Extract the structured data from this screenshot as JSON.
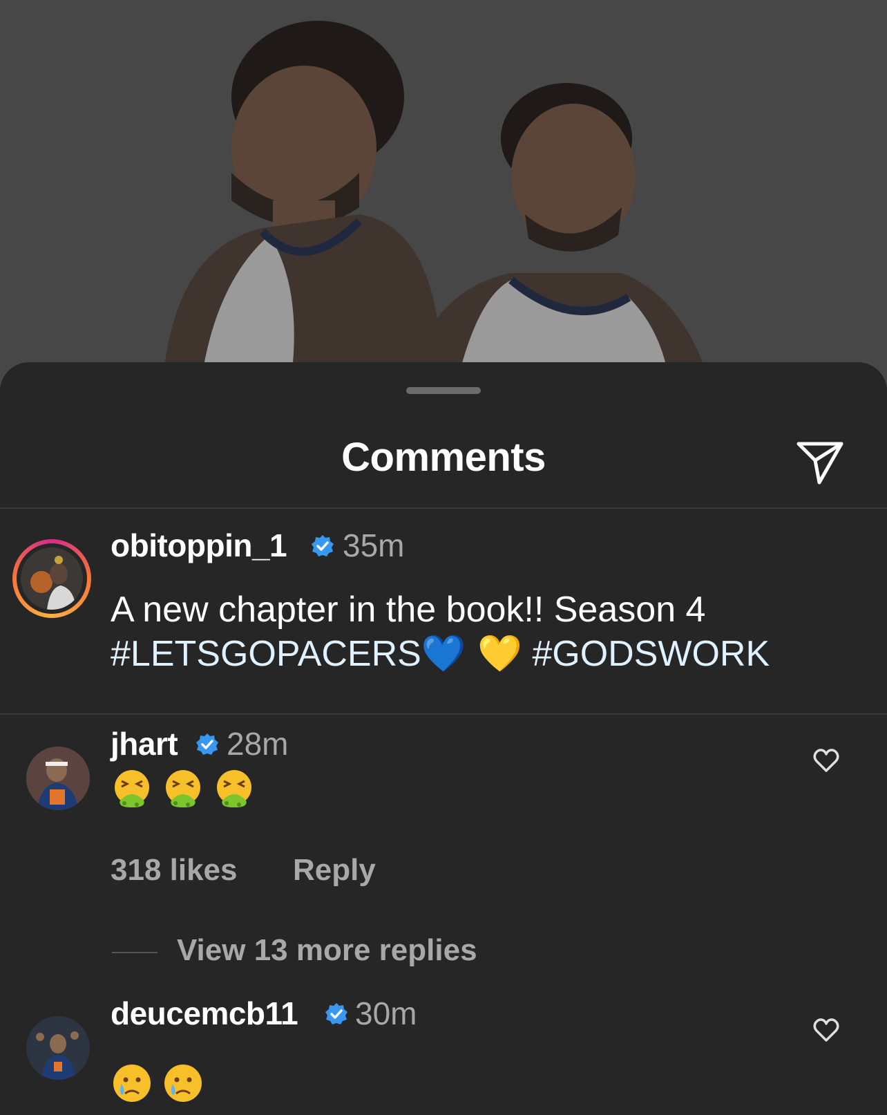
{
  "sheet": {
    "title": "Comments"
  },
  "post_caption": {
    "username": "obitoppin_1",
    "time": "35m",
    "text_line1": "A new chapter in the book!! Season 4",
    "hashtag1": "#LETSGOPACERS",
    "hearts": "💙 💛",
    "hashtag2": "#GODSWORK"
  },
  "comments": [
    {
      "username": "jhart",
      "time": "28m",
      "emoji": "🤮🤮🤮",
      "likes": "318 likes",
      "reply_label": "Reply",
      "view_replies": "View 13 more replies"
    },
    {
      "username": "deucemcb11",
      "time": "30m",
      "emoji": "😢😢"
    }
  ],
  "icons": {
    "share": "paper-plane-icon",
    "verified": "verified-badge-icon",
    "like": "heart-outline-icon"
  },
  "colors": {
    "background": "#262626",
    "verified": "#3897f0",
    "hashtag": "#e0f1ff",
    "secondary_text": "#a8a8a8"
  }
}
